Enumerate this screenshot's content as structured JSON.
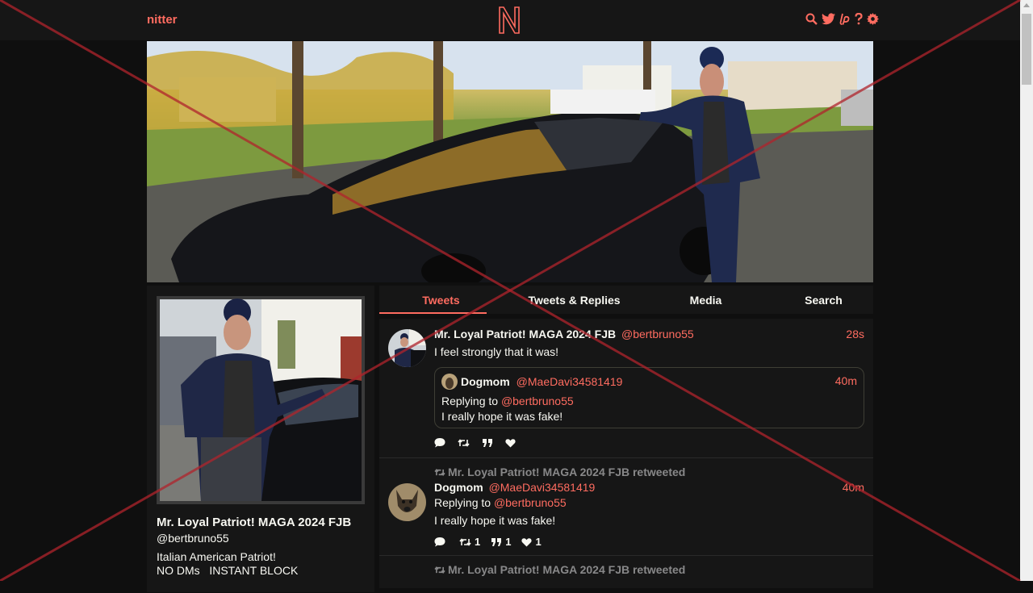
{
  "nav": {
    "brand": "nitter",
    "logo_letter": "N",
    "icons": [
      "search-icon",
      "twitter-bird-icon",
      "liberapay-icon",
      "help-icon",
      "settings-gear-icon"
    ],
    "accent": "#ff6c60"
  },
  "profile": {
    "fullname": "Mr. Loyal Patriot! MAGA 2024 FJB",
    "username": "@bertbruno55",
    "bio_line1": "Italian American Patriot!",
    "bio_line2": "NO DMs   INSTANT BLOCK"
  },
  "tabs": [
    {
      "label": "Tweets",
      "active": true
    },
    {
      "label": "Tweets & Replies",
      "active": false
    },
    {
      "label": "Media",
      "active": false
    },
    {
      "label": "Search",
      "active": false
    }
  ],
  "tweets": [
    {
      "fullname": "Mr. Loyal Patriot! MAGA 2024 FJB",
      "username": "@bertbruno55",
      "date": "28s",
      "content": "I feel strongly that it was!",
      "quote": {
        "fullname": "Dogmom",
        "username": "@MaeDavi34581419",
        "date": "40m",
        "replying_label": "Replying to",
        "replying_to": "@bertbruno55",
        "content": "I really hope it was fake!"
      },
      "stats": {
        "replies": "",
        "retweets": "",
        "quotes": "",
        "likes": ""
      }
    },
    {
      "retweet_header": "Mr. Loyal Patriot! MAGA 2024 FJB retweeted",
      "fullname": "Dogmom",
      "username": "@MaeDavi34581419",
      "date": "40m",
      "replying_label": "Replying to",
      "replying_to": "@bertbruno55",
      "content": "I really hope it was fake!",
      "stats": {
        "replies": "",
        "retweets": "1",
        "quotes": "1",
        "likes": "1"
      }
    },
    {
      "retweet_header": "Mr. Loyal Patriot! MAGA 2024 FJB retweeted"
    }
  ]
}
